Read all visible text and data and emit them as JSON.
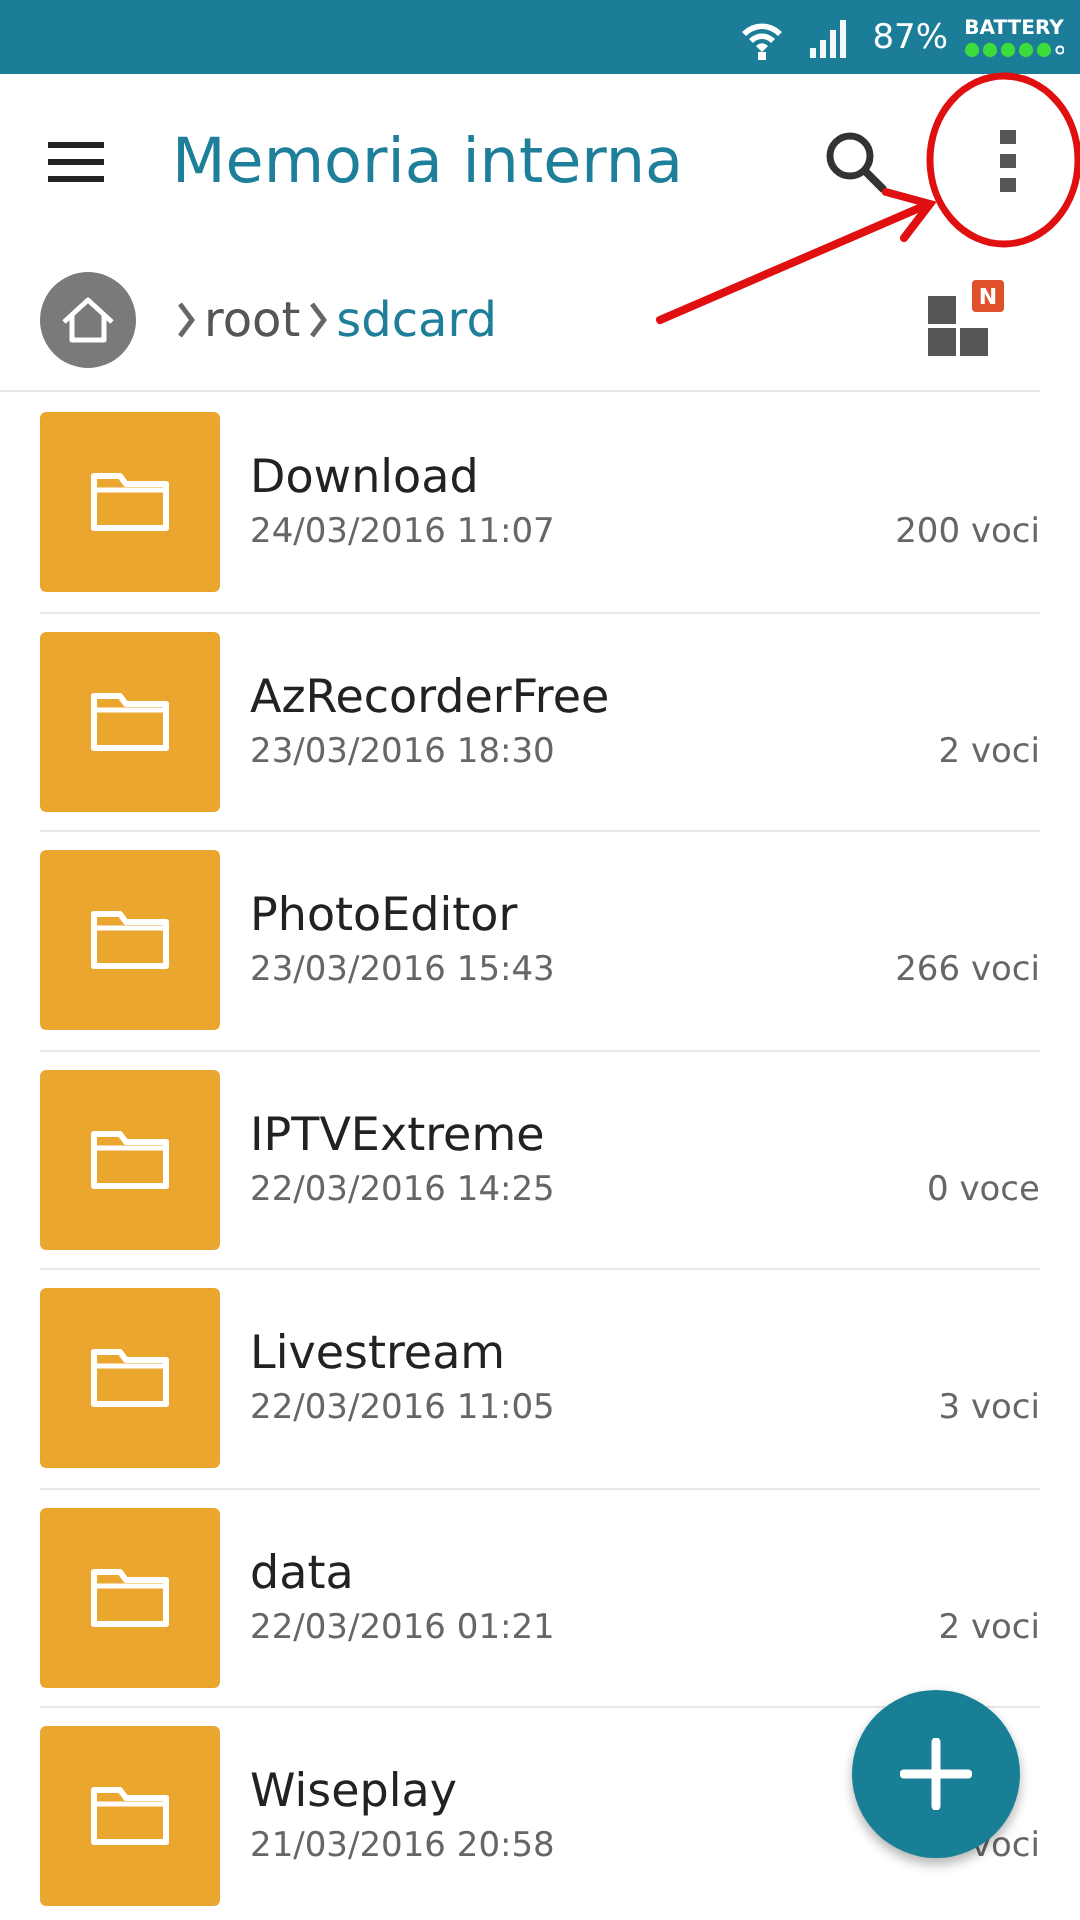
{
  "status_bar": {
    "battery_percent": "87%",
    "battery_label": "BATTERY"
  },
  "toolbar": {
    "title": "Memoria interna"
  },
  "breadcrumb": [
    {
      "label": "root",
      "selected": false
    },
    {
      "label": "sdcard",
      "selected": true
    }
  ],
  "grid_toggle": {
    "badge": "N"
  },
  "folders": [
    {
      "name": "Download",
      "date": "24/03/2016 11:07",
      "count": "200 voci"
    },
    {
      "name": "AzRecorderFree",
      "date": "23/03/2016 18:30",
      "count": "2 voci"
    },
    {
      "name": "PhotoEditor",
      "date": "23/03/2016 15:43",
      "count": "266 voci"
    },
    {
      "name": "IPTVExtreme",
      "date": "22/03/2016 14:25",
      "count": "0 voce"
    },
    {
      "name": "Livestream",
      "date": "22/03/2016 11:05",
      "count": "3 voci"
    },
    {
      "name": "data",
      "date": "22/03/2016 01:21",
      "count": "2 voci"
    },
    {
      "name": "Wiseplay",
      "date": "21/03/2016 20:58",
      "count": "voci"
    }
  ]
}
